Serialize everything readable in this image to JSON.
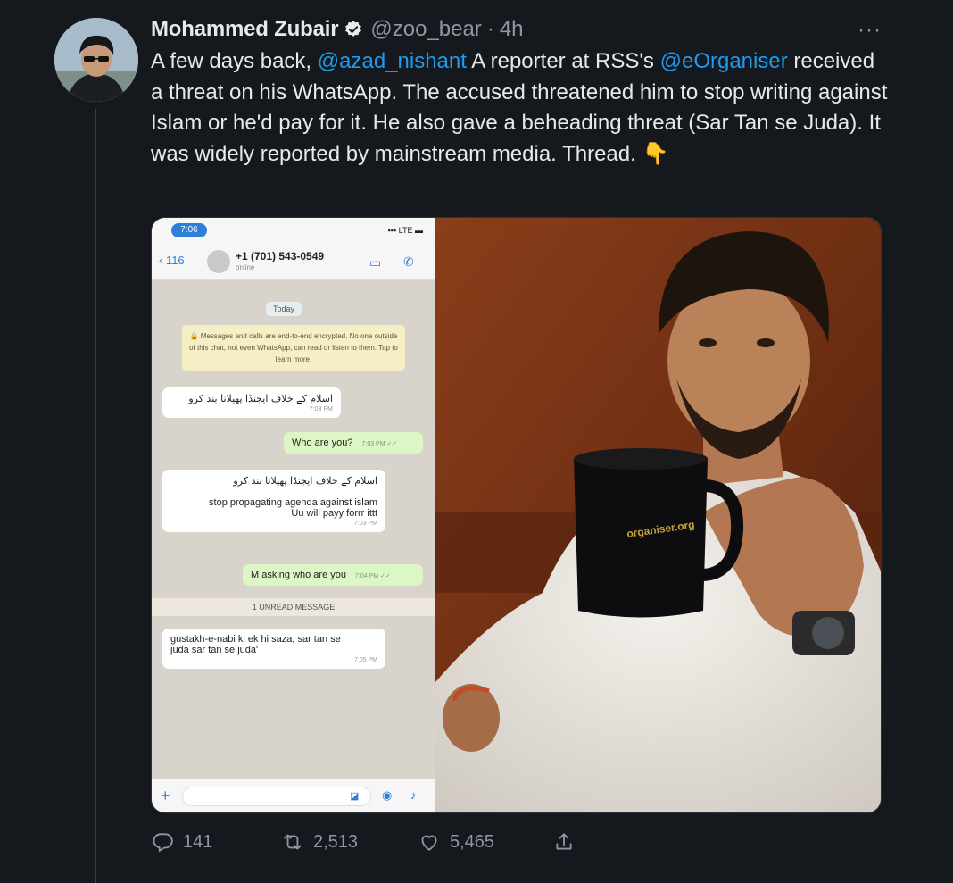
{
  "tweet": {
    "display_name": "Mohammed Zubair",
    "handle": "@zoo_bear",
    "separator": "·",
    "time": "4h",
    "more": "···",
    "text": {
      "part1": "A few days back, ",
      "mention1": "@azad_nishant",
      "part2": " A reporter at RSS's ",
      "mention2": "@eOrganiser",
      "part3": " received a threat on his WhatsApp. The accused threatened him to stop writing against Islam or he'd pay for it. He also gave a beheading threat (Sar Tan se Juda). It was widely reported by mainstream media. Thread. ",
      "emoji": "👇"
    },
    "stats": {
      "replies": "141",
      "retweets": "2,513",
      "likes": "5,465"
    }
  },
  "whatsapp": {
    "status_time": "7:06",
    "status_signal": "▪▪▪ LTE ▬",
    "back": "‹ 116",
    "contact": "+1 (701) 543-0549",
    "contact_sub": "online",
    "day": "Today",
    "notice": "🔒 Messages and calls are end-to-end encrypted. No one outside of this chat, not even WhatsApp, can read or listen to them. Tap to learn more.",
    "msg1": {
      "text": "اسلام کے خلاف ایجنڈا پھیلانا بند کرو",
      "time": "7:03 PM"
    },
    "msg2": {
      "text": "Who are you?",
      "time": "7:03 PM ✓✓"
    },
    "msg3": {
      "text_urdu": "اسلام کے خلاف ایجنڈا پھیلانا بند کرو",
      "line1": "stop propagating agenda against islam",
      "line2": "Uu will payy forrr ittt",
      "time": "7:03 PM"
    },
    "msg4": {
      "text": "M asking who are you",
      "time": "7:04 PM ✓✓"
    },
    "unread": "1 UNREAD MESSAGE",
    "msg5": {
      "line1": "gustakh-e-nabi ki ek hi saza, sar tan se",
      "line2": "juda sar tan se juda'",
      "time": "7:05 PM"
    }
  },
  "photo": {
    "mug_brand": "organiser.org"
  },
  "colors": {
    "background": "#15181c",
    "text": "#e7e9ea",
    "muted": "#8b98a5",
    "accent": "#1d9bf0"
  },
  "icons": {
    "verified": "verified-badge-icon",
    "reply": "reply-icon",
    "retweet": "retweet-icon",
    "like": "heart-icon",
    "share": "share-icon"
  }
}
